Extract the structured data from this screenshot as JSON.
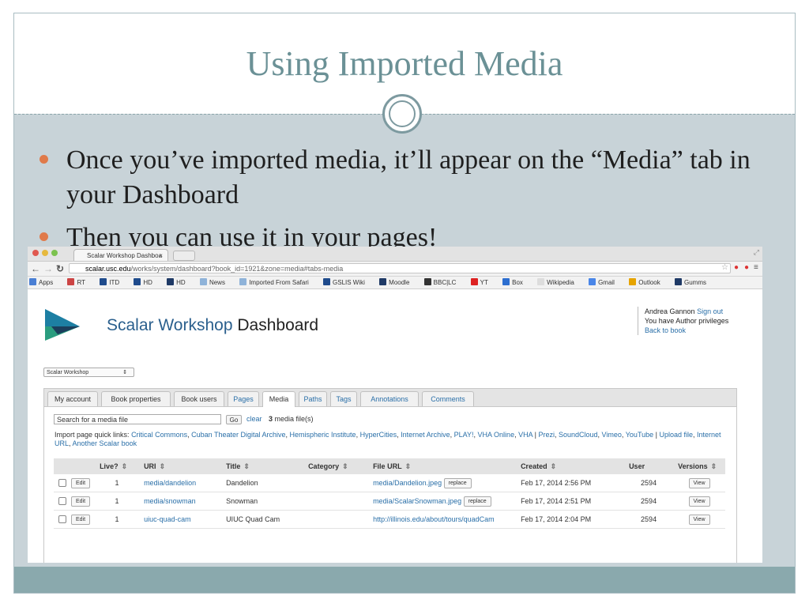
{
  "slide": {
    "title": "Using Imported Media",
    "bullets": [
      "Once you’ve imported media, it’ll appear on the “Media” tab in your Dashboard",
      "Then you can use it in your pages!"
    ],
    "colors": {
      "title": "#6b9196",
      "bullet": "#e07a4a",
      "background": "#c8d3d8",
      "footer": "#8aa9ad"
    }
  },
  "browser": {
    "tab_title": "Scalar Workshop Dashboa",
    "tab_close": "×",
    "url_host": "scalar.usc.edu",
    "url_path": "/works/system/dashboard?book_id=1921&zone=media#tabs-media",
    "bookmarks": [
      "Apps",
      "RT",
      "ITD",
      "HD",
      "HD",
      "News",
      "Imported From Safari",
      "GSLIS Wiki",
      "Moodle",
      "BBC|LC",
      "YT",
      "Box",
      "Wikipedia",
      "Gmail",
      "Outlook",
      "Gumms"
    ]
  },
  "dashboard": {
    "brand_name": "Scalar Workshop",
    "brand_suffix": "Dashboard",
    "user_name": "Andrea Gannon",
    "sign_out": "Sign out",
    "privileges": "You have Author privileges",
    "back_to_book": "Back to book",
    "book_select": "Scalar Workshop",
    "tabs": [
      "My account",
      "Book properties",
      "Book users",
      "Pages",
      "Media",
      "Paths",
      "Tags",
      "Annotations",
      "Comments"
    ],
    "search_placeholder": "Search for a media file",
    "go_label": "Go",
    "clear_label": "clear",
    "count_number": "3",
    "count_text": "media file(s)",
    "quick_prefix": "Import page quick links:",
    "quick_links": [
      "Critical Commons",
      "Cuban Theater Digital Archive",
      "Hemispheric Institute",
      "HyperCities",
      "Internet Archive",
      "PLAY!",
      "VHA Online",
      "VHA",
      "Prezi",
      "SoundCloud",
      "Vimeo",
      "YouTube",
      "Upload file",
      "Internet URL",
      "Another Scalar book"
    ],
    "columns": [
      "Live?",
      "URI",
      "Title",
      "Category",
      "File URL",
      "Created",
      "User",
      "Versions"
    ],
    "rows": [
      {
        "edit": "Edit",
        "live": "1",
        "uri": "media/dandelion",
        "title": "Dandelion",
        "category": "",
        "file_url": "media/Dandelion.jpeg",
        "replace": "replace",
        "created": "Feb 17, 2014 2:56 PM",
        "user": "2594",
        "versions": "View"
      },
      {
        "edit": "Edit",
        "live": "1",
        "uri": "media/snowman",
        "title": "Snowman",
        "category": "",
        "file_url": "media/ScalarSnowman.jpeg",
        "replace": "replace",
        "created": "Feb 17, 2014 2:51 PM",
        "user": "2594",
        "versions": "View"
      },
      {
        "edit": "Edit",
        "live": "1",
        "uri": "uiuc-quad-cam",
        "title": "UIUC Quad Cam",
        "category": "",
        "file_url": "http://illinois.edu/about/tours/quadCam",
        "replace": "",
        "created": "Feb 17, 2014 2:04 PM",
        "user": "2594",
        "versions": "View"
      }
    ]
  }
}
